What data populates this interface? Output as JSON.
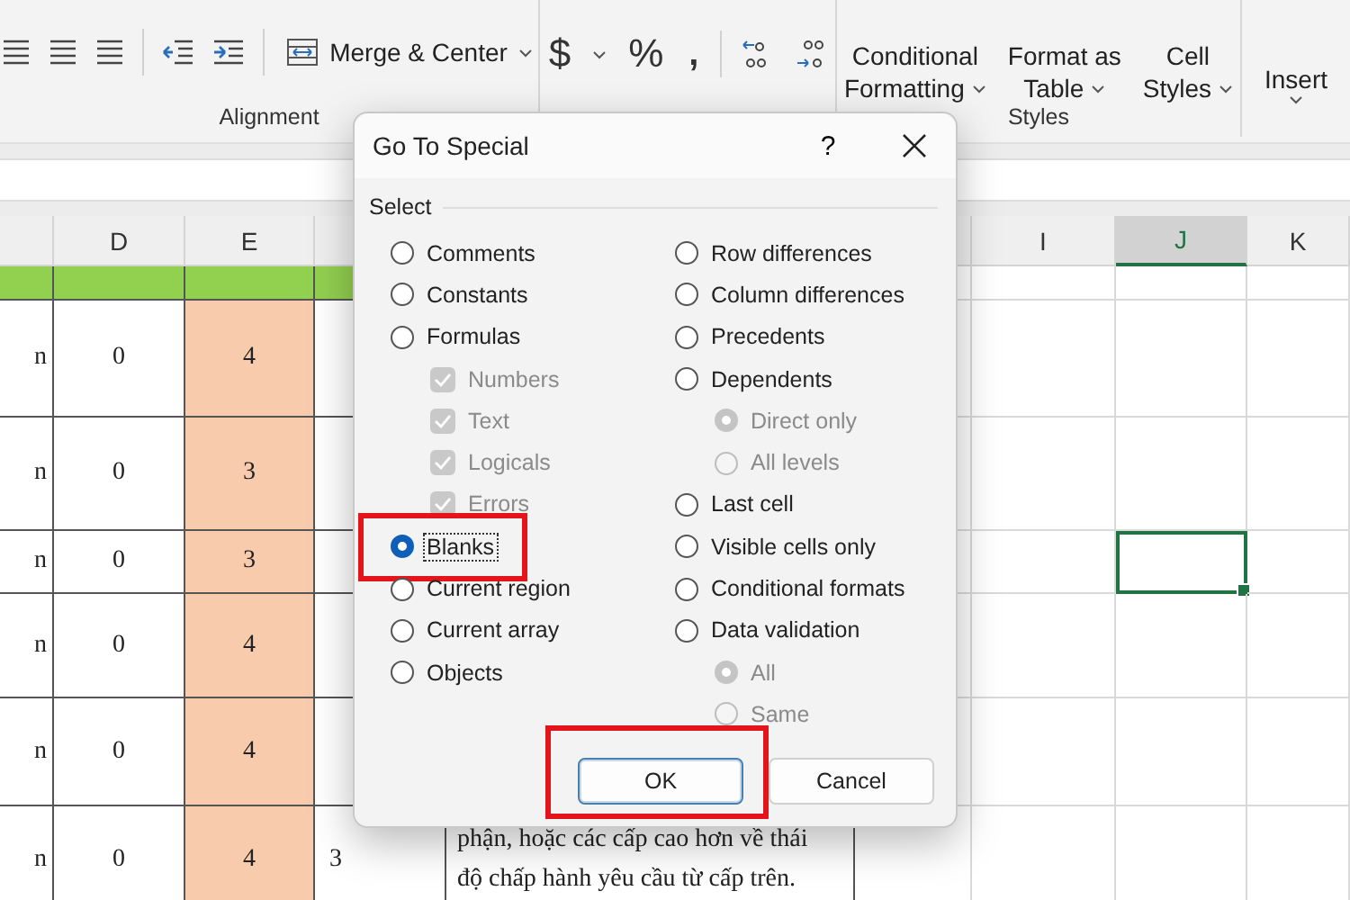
{
  "ribbon": {
    "groups": [
      {
        "kind": "alignment",
        "label": "Alignment",
        "merge_button": "Merge & Center"
      },
      {
        "kind": "number",
        "symbols": [
          "$",
          "%",
          ","
        ]
      },
      {
        "kind": "styles",
        "label": "Styles",
        "buttons": [
          {
            "lines": [
              "Conditional",
              "Formatting"
            ]
          },
          {
            "lines": [
              "Format as",
              "Table"
            ]
          },
          {
            "lines": [
              "Cell",
              "Styles"
            ]
          }
        ]
      },
      {
        "kind": "cells",
        "buttons": [
          {
            "lines": [
              "Insert"
            ]
          }
        ]
      }
    ]
  },
  "columns": [
    {
      "selected": false
    },
    {
      "label": "D",
      "selected": false
    },
    {
      "label": "E",
      "selected": false
    },
    {
      "selected": false
    },
    {},
    {
      "selected": false
    },
    {
      "label": "I",
      "selected": false
    },
    {
      "label": "J",
      "selected": true
    },
    {
      "label": "K",
      "selected": false
    }
  ],
  "rows": [
    {
      "kind": "band",
      "j_selected": false
    },
    {
      "kind": "data",
      "c": "n",
      "d": "0",
      "e": "4",
      "j_selected": false
    },
    {
      "kind": "data",
      "c": "n",
      "d": "0",
      "e": "3",
      "j_selected": false
    },
    {
      "kind": "data",
      "c": "n",
      "d": "0",
      "e": "3",
      "j_selected": true
    },
    {
      "kind": "data",
      "c": "n",
      "d": "0",
      "e": "4",
      "j_selected": false
    },
    {
      "kind": "data",
      "c": "n",
      "d": "0",
      "e": "4",
      "j_selected": false
    },
    {
      "kind": "data",
      "c": "n",
      "d": "0",
      "e": "4",
      "f": "3",
      "g_lines": [
        "phận, hoặc các cấp cao hơn về thái",
        "độ chấp hành yêu cầu từ cấp trên."
      ],
      "j_selected": false
    }
  ],
  "dialog": {
    "title": "Go To Special",
    "help": "?",
    "section": "Select",
    "left": [
      {
        "label": "Comments",
        "kind": "radio",
        "selected": false,
        "disabled": false,
        "indented": false,
        "highlighted": false
      },
      {
        "label": "Constants",
        "kind": "radio",
        "selected": false,
        "disabled": false,
        "indented": false,
        "highlighted": false
      },
      {
        "label": "Formulas",
        "kind": "radio",
        "selected": false,
        "disabled": false,
        "indented": false,
        "highlighted": false
      },
      {
        "label": "Numbers",
        "kind": "checkbox",
        "checked": true,
        "disabled": true,
        "indented": true,
        "highlighted": false
      },
      {
        "label": "Text",
        "kind": "checkbox",
        "checked": true,
        "disabled": true,
        "indented": true,
        "highlighted": false
      },
      {
        "label": "Logicals",
        "kind": "checkbox",
        "checked": true,
        "disabled": true,
        "indented": true,
        "highlighted": false
      },
      {
        "label": "Errors",
        "kind": "checkbox",
        "checked": true,
        "disabled": true,
        "indented": true,
        "highlighted": false
      },
      {
        "label": "Blanks",
        "kind": "radio",
        "selected": true,
        "disabled": false,
        "indented": false,
        "highlighted": true
      },
      {
        "label": "Current region",
        "kind": "radio",
        "selected": false,
        "disabled": false,
        "indented": false,
        "highlighted": false
      },
      {
        "label": "Current array",
        "kind": "radio",
        "selected": false,
        "disabled": false,
        "indented": false,
        "highlighted": false
      },
      {
        "label": "Objects",
        "kind": "radio",
        "selected": false,
        "disabled": false,
        "indented": false,
        "highlighted": false
      }
    ],
    "right": [
      {
        "label": "Row differences",
        "kind": "radio",
        "selected": false,
        "disabled": false,
        "indented": false,
        "highlighted": false
      },
      {
        "label": "Column differences",
        "kind": "radio",
        "selected": false,
        "disabled": false,
        "indented": false,
        "highlighted": false
      },
      {
        "label": "Precedents",
        "kind": "radio",
        "selected": false,
        "disabled": false,
        "indented": false,
        "highlighted": false
      },
      {
        "label": "Dependents",
        "kind": "radio",
        "selected": false,
        "disabled": false,
        "indented": false,
        "highlighted": false
      },
      {
        "label": "Direct only",
        "kind": "radio",
        "selected": true,
        "disabled": true,
        "indented": true,
        "highlighted": false
      },
      {
        "label": "All levels",
        "kind": "radio",
        "selected": false,
        "disabled": true,
        "indented": true,
        "highlighted": false
      },
      {
        "label": "Last cell",
        "kind": "radio",
        "selected": false,
        "disabled": false,
        "indented": false,
        "highlighted": false
      },
      {
        "label": "Visible cells only",
        "kind": "radio",
        "selected": false,
        "disabled": false,
        "indented": false,
        "highlighted": false
      },
      {
        "label": "Conditional formats",
        "kind": "radio",
        "selected": false,
        "disabled": false,
        "indented": false,
        "highlighted": false
      },
      {
        "label": "Data validation",
        "kind": "radio",
        "selected": false,
        "disabled": false,
        "indented": false,
        "highlighted": false
      },
      {
        "label": "All",
        "kind": "radio",
        "selected": true,
        "disabled": true,
        "indented": true,
        "highlighted": false
      },
      {
        "label": "Same",
        "kind": "radio",
        "selected": false,
        "disabled": true,
        "indented": true,
        "highlighted": false
      }
    ],
    "buttons": [
      {
        "label": "OK",
        "default": true,
        "highlighted": true
      },
      {
        "label": "Cancel",
        "default": false
      }
    ]
  }
}
